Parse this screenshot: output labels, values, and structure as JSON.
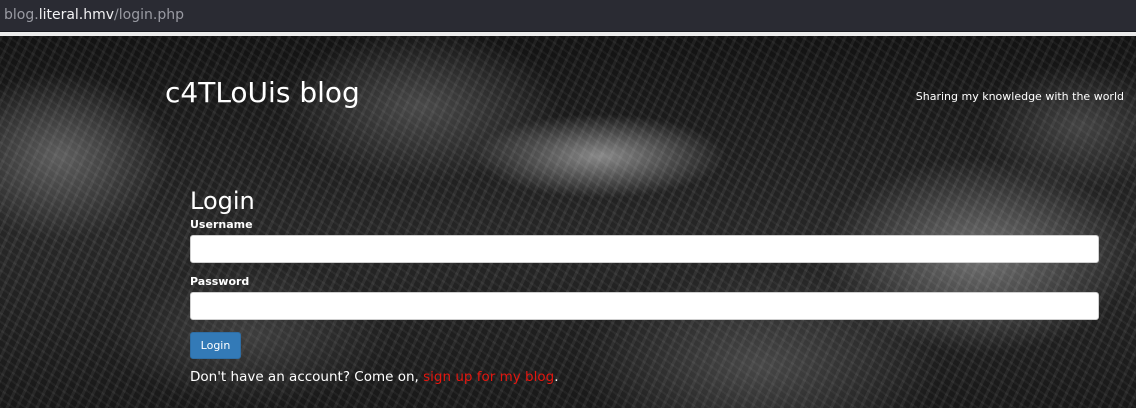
{
  "browser": {
    "url_subdomain": "blog.",
    "url_host": "literal.hmv",
    "url_path": "/login.php"
  },
  "header": {
    "site_title": "c4TLoUis blog",
    "tagline": "Sharing my knowledge with the world"
  },
  "login_form": {
    "heading": "Login",
    "username_label": "Username",
    "username_value": "",
    "password_label": "Password",
    "password_value": "",
    "submit_label": "Login",
    "signup_prefix": "Don't have an account? Come on, ",
    "signup_link": "sign up for my blog",
    "signup_suffix": "."
  },
  "colors": {
    "button_bg": "#337ab7",
    "link": "#e3160f",
    "urlbar_bg": "#2a2b33"
  }
}
